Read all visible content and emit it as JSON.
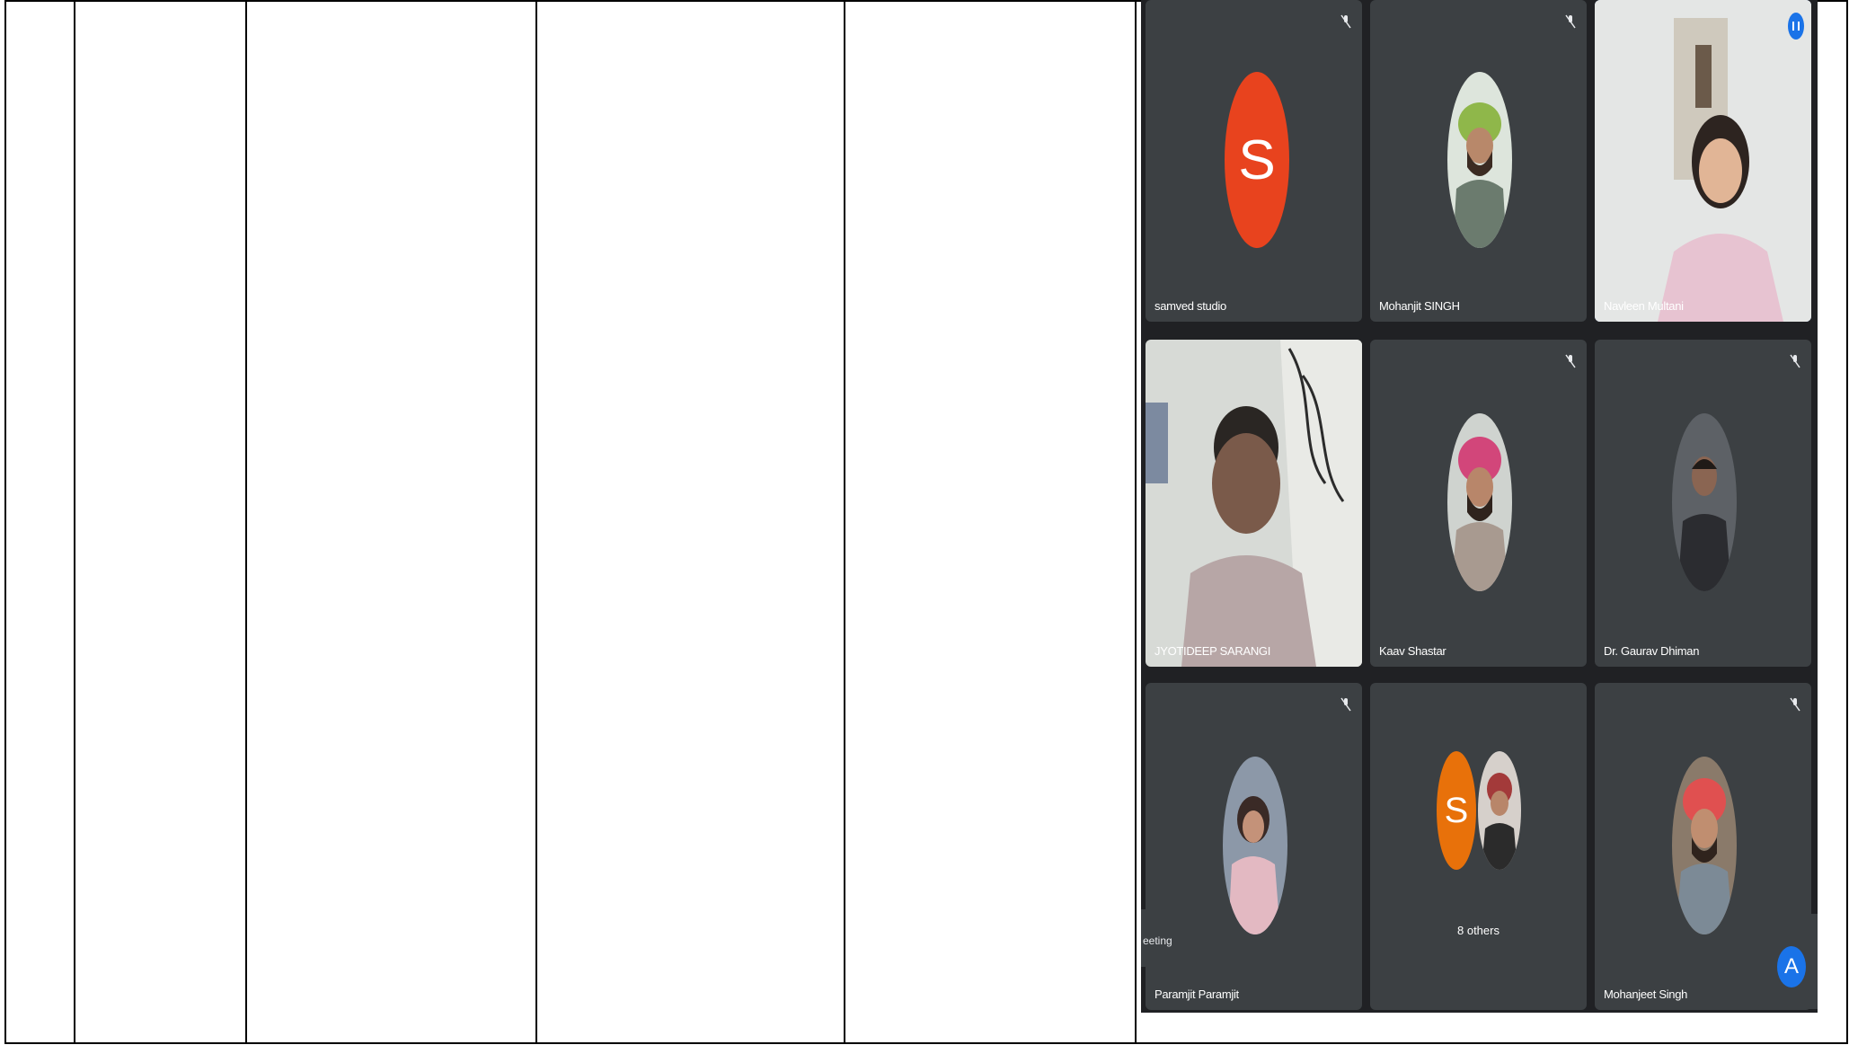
{
  "document": {
    "columns": 6
  },
  "meeting": {
    "participants": [
      {
        "name": "samved studio",
        "avatar_letter": "S",
        "avatar_color": "#e8431e",
        "muted": true
      },
      {
        "name": "Mohanjit SINGH",
        "muted": true
      },
      {
        "name": "Navleen Multani",
        "speaking": true,
        "video": true
      },
      {
        "name": "JYOTIDEEP SARANGI",
        "video": true
      },
      {
        "name": "Kaav Shastar",
        "muted": true
      },
      {
        "name": "Dr. Gaurav Dhiman",
        "muted": true
      },
      {
        "name": "Paramjit Paramjit",
        "muted": true
      },
      {
        "name": "Mohanjeet Singh",
        "muted": true
      }
    ],
    "others": {
      "label": "8 others",
      "avatar_letter": "S",
      "avatar_color": "#e8710a"
    },
    "meeting_chip": "eeting",
    "self_avatar_letter": "A",
    "colors": {
      "background": "#202124",
      "tile": "#3c4043",
      "accent": "#1a73e8"
    }
  }
}
